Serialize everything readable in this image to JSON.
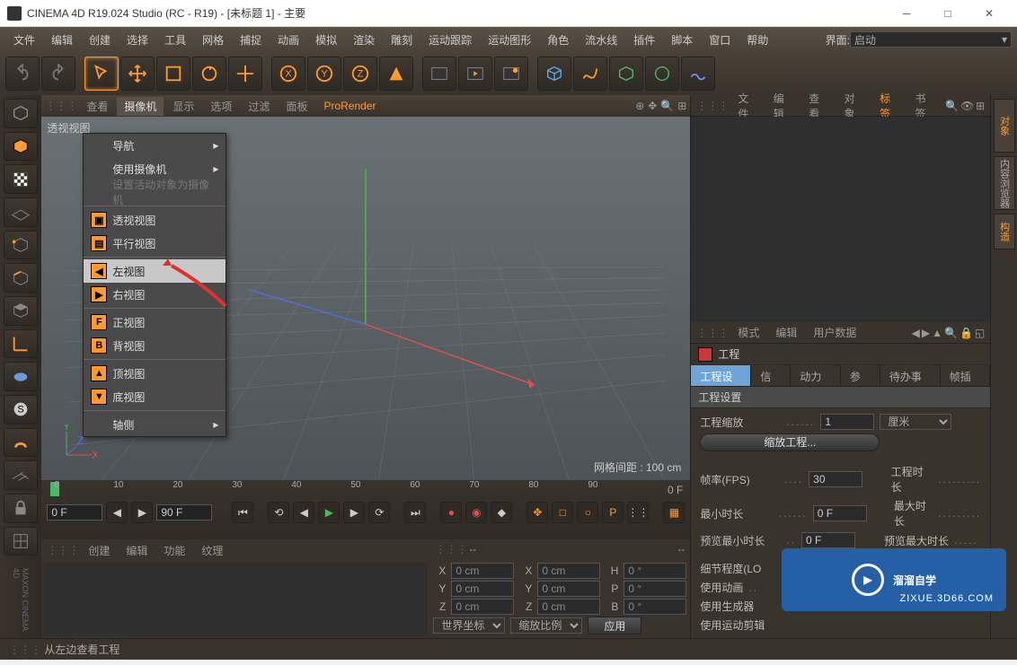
{
  "title": "CINEMA 4D R19.024 Studio (RC - R19) - [未标题 1] - 主要",
  "menubar": [
    "文件",
    "编辑",
    "创建",
    "选择",
    "工具",
    "网格",
    "捕捉",
    "动画",
    "模拟",
    "渲染",
    "雕刻",
    "运动跟踪",
    "运动图形",
    "角色",
    "流水线",
    "插件",
    "脚本",
    "窗口",
    "帮助"
  ],
  "layout_label": "界面:",
  "layout_value": "启动",
  "viewport_tabs": {
    "view": "查看",
    "camera": "摄像机",
    "display": "显示",
    "options": "选项",
    "filter": "过滤",
    "panel": "面板",
    "pro": "ProRender",
    "persp": "透视视图"
  },
  "dropdown": {
    "nav": "导航",
    "usecam": "使用摄像机",
    "setactive": "设置活动对象为摄像机",
    "persp": "透视视图",
    "parallel": "平行视图",
    "left": "左视图",
    "right": "右视图",
    "front": "正视图",
    "back": "背视图",
    "top": "顶视图",
    "bottom": "底视图",
    "axo": "轴侧"
  },
  "axis": {
    "x": "X",
    "y": "Y",
    "z": "Z"
  },
  "grid_label": "网格间距 : 100 cm",
  "timeline": {
    "ticks": [
      "0",
      "10",
      "20",
      "30",
      "40",
      "50",
      "60",
      "70",
      "80",
      "90"
    ],
    "start": "0 F",
    "end": "90 F",
    "cur": "0 F"
  },
  "coord": {
    "menu": [
      "创建",
      "编辑",
      "功能",
      "纹理"
    ],
    "dashes": "--",
    "X": "X",
    "Y": "Y",
    "Z": "Z",
    "H": "H",
    "P": "P",
    "B": "B",
    "zero_cm": "0 cm",
    "zero_deg": "0 °",
    "world": "世界坐标",
    "scale": "缩放比例",
    "apply": "应用"
  },
  "right": {
    "tabs1": [
      "文件",
      "编辑",
      "查看",
      "对象"
    ],
    "tabs1b": [
      "标签",
      "书签"
    ],
    "mode": "模式",
    "edit": "编辑",
    "userdata": "用户数据",
    "project": "工程",
    "tabs2": [
      "工程设置",
      "信息",
      "动力学",
      "参考",
      "待办事项",
      "帧插值"
    ],
    "header2": "工程设置",
    "scale": "工程缩放",
    "scale_v": "1",
    "unit": "厘米",
    "scalebtn": "缩放工程...",
    "fps": "帧率(FPS)",
    "fps_v": "30",
    "duration": "工程时长",
    "mintime": "最小时长",
    "mintime_v": "0 F",
    "maxtime": "最大时长",
    "pmin": "预览最小时长",
    "pmin_v": "0 F",
    "pmax": "预览最大时长",
    "lod": "细节程度(LO",
    "useanim": "使用动画",
    "usegen": "使用生成器",
    "usemotion": "使用运动剪辑"
  },
  "rightstrip": [
    "对象",
    "内容浏览器",
    "构造"
  ],
  "status": "从左边查看工程",
  "watermark": {
    "text": "溜溜自学",
    "sub": "ZIXUE.3D66.COM"
  },
  "maxon": "MAXON CINEMA 4D"
}
